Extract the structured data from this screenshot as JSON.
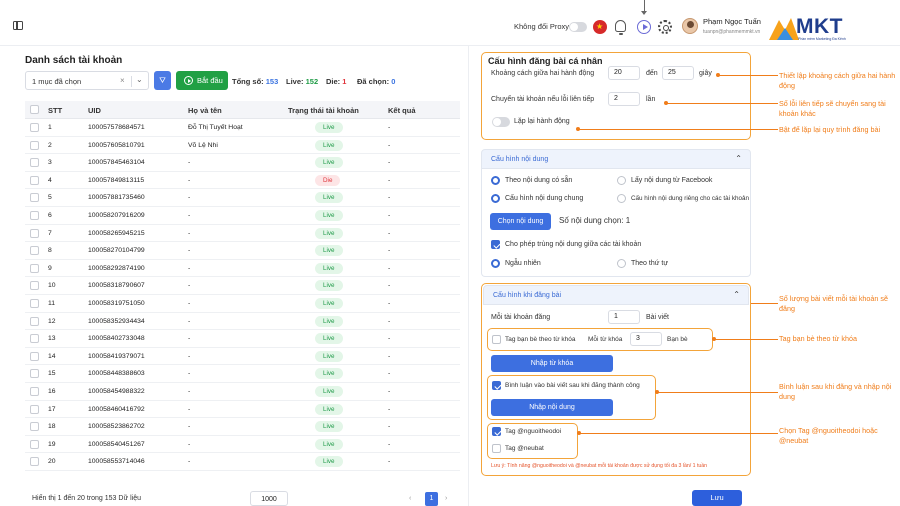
{
  "header": {
    "proxy_label": "Không đổi Proxy",
    "user_name": "Phạm Ngọc Tuấn",
    "user_email": "tuanpn@phanmemmkt.vn",
    "logo_text": "MKT",
    "logo_sub": "Phần mềm Marketing Đa Kênh"
  },
  "left": {
    "title": "Danh sách tài khoản",
    "select_value": "1 mục đã chọn",
    "start_label": "Bắt đầu",
    "stats": {
      "total_label": "Tổng số:",
      "total": "153",
      "live_label": "Live:",
      "live": "152",
      "die_label": "Die:",
      "die": "1",
      "selected_label": "Đã chọn:",
      "selected": "0"
    },
    "columns": [
      "STT",
      "UID",
      "Họ và tên",
      "Trạng thái tài khoản",
      "Kết quả"
    ],
    "rows": [
      {
        "stt": "1",
        "uid": "100057578684571",
        "name": "Đỗ Thị Tuyết Hoạt",
        "status": "Live",
        "result": "-"
      },
      {
        "stt": "2",
        "uid": "100057605810791",
        "name": "Võ Lệ Nhi",
        "status": "Live",
        "result": "-"
      },
      {
        "stt": "3",
        "uid": "100057845463104",
        "name": "-",
        "status": "Live",
        "result": "-"
      },
      {
        "stt": "4",
        "uid": "100057849813115",
        "name": "-",
        "status": "Die",
        "result": "-"
      },
      {
        "stt": "5",
        "uid": "100057881735460",
        "name": "-",
        "status": "Live",
        "result": "-"
      },
      {
        "stt": "6",
        "uid": "100058207916209",
        "name": "-",
        "status": "Live",
        "result": "-"
      },
      {
        "stt": "7",
        "uid": "100058265945215",
        "name": "-",
        "status": "Live",
        "result": "-"
      },
      {
        "stt": "8",
        "uid": "100058270104799",
        "name": "-",
        "status": "Live",
        "result": "-"
      },
      {
        "stt": "9",
        "uid": "100058292874190",
        "name": "-",
        "status": "Live",
        "result": "-"
      },
      {
        "stt": "10",
        "uid": "100058318790607",
        "name": "-",
        "status": "Live",
        "result": "-"
      },
      {
        "stt": "11",
        "uid": "100058319751050",
        "name": "-",
        "status": "Live",
        "result": "-"
      },
      {
        "stt": "12",
        "uid": "100058352934434",
        "name": "-",
        "status": "Live",
        "result": "-"
      },
      {
        "stt": "13",
        "uid": "100058402733048",
        "name": "-",
        "status": "Live",
        "result": "-"
      },
      {
        "stt": "14",
        "uid": "100058419379071",
        "name": "-",
        "status": "Live",
        "result": "-"
      },
      {
        "stt": "15",
        "uid": "100058448388603",
        "name": "-",
        "status": "Live",
        "result": "-"
      },
      {
        "stt": "16",
        "uid": "100058454988322",
        "name": "-",
        "status": "Live",
        "result": "-"
      },
      {
        "stt": "17",
        "uid": "100058460416792",
        "name": "-",
        "status": "Live",
        "result": "-"
      },
      {
        "stt": "18",
        "uid": "100058523862702",
        "name": "-",
        "status": "Live",
        "result": "-"
      },
      {
        "stt": "19",
        "uid": "100058540451267",
        "name": "-",
        "status": "Live",
        "result": "-"
      },
      {
        "stt": "20",
        "uid": "100058553714046",
        "name": "-",
        "status": "Live",
        "result": "-"
      }
    ],
    "footer_text": "Hiển thị 1 đến 20 trong 153 Dữ liệu",
    "page_size": "1000",
    "page_prev": "‹",
    "page_current": "1",
    "page_next": "›"
  },
  "personal": {
    "title": "Cấu hình đăng bài cá nhân",
    "interval_label": "Khoảng cách giữa hai hành động",
    "interval_from": "20",
    "interval_to_label": "đến",
    "interval_to": "25",
    "interval_unit": "giây",
    "switch_label": "Chuyển tài khoản nếu lỗi liên tiếp",
    "switch_value": "2",
    "switch_unit": "lần",
    "repeat_label": "Lặp lại hành động"
  },
  "content": {
    "title": "Cấu hình nội dung",
    "opt_existing": "Theo nội dung có sẵn",
    "opt_facebook": "Lấy nội dung từ Facebook",
    "opt_common": "Cấu hình nội dung chung",
    "opt_separate": "Cấu hình nội dung riêng cho các tài khoản",
    "choose_button": "Chọn nội dung",
    "count_text": "Số nội dung chọn: 1",
    "allow_dup": "Cho phép trùng nội dung giữa các tài khoản",
    "opt_random": "Ngẫu nhiên",
    "opt_order": "Theo thứ tự"
  },
  "posting": {
    "title": "Cấu hình khi đăng bài",
    "per_account_label": "Mỗi tài khoản đăng",
    "per_account_value": "1",
    "per_account_unit": "Bài viết",
    "tag_friends_label": "Tag bạn bè theo từ khóa",
    "per_keyword_label": "Mỗi từ khóa",
    "per_keyword_value": "3",
    "per_keyword_unit": "Bạn bè",
    "keyword_button": "Nhập từ khóa",
    "comment_label": "Bình luận vào bài viết sau khi đăng thành công",
    "content_button": "Nhập nội dung",
    "tag_follow": "Tag @nguoitheodoi",
    "tag_neubat": "Tag @neubat",
    "note": "Lưu ý: Tính năng @nguoitheodoi và @neubat mỗi tài khoản được sử dụng tối đa 3 lần/ 1 tuần",
    "save_button": "Lưu"
  },
  "annotations": {
    "a1": "Thiết lập khoảng cách giữa hai hành động",
    "a2": "Số lỗi liên tiếp sẽ chuyển sang tài khoản khác",
    "a3": "Bật để lặp lại quy trình đăng bài",
    "a4": "Số lượng bài viết mỗi tài khoản sẽ đăng",
    "a5": "Tag bạn bè theo từ khóa",
    "a6": "Bình luận sau khi đăng và nhập nội dung",
    "a7": "Chọn Tag @nguoitheodoi hoặc @neubat"
  },
  "colors": {
    "primary": "#3d6fe0",
    "start_green": "#21a044",
    "annotation_orange": "#f07d1a",
    "live_green": "#1f9a49",
    "die_red": "#e0353c"
  }
}
